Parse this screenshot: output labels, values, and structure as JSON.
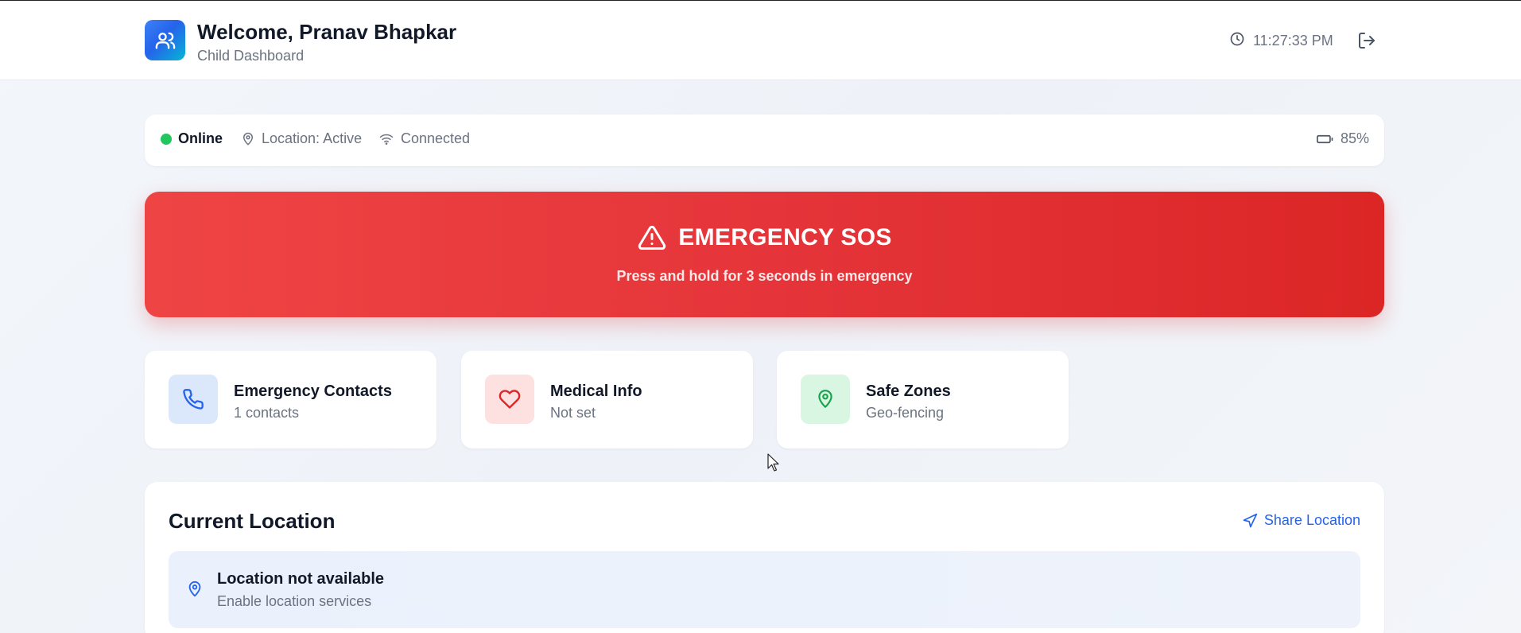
{
  "header": {
    "welcome": "Welcome, Pranav Bhapkar",
    "subtitle": "Child Dashboard",
    "time": "11:27:33 PM",
    "brand_icon": "users-icon",
    "clock_icon": "clock-icon",
    "logout_icon": "logout-icon"
  },
  "status": {
    "online": "Online",
    "location": "Location: Active",
    "connection": "Connected",
    "battery": "85%",
    "online_color": "#22c55e"
  },
  "sos": {
    "title": "EMERGENCY SOS",
    "subtitle": "Press and hold for 3 seconds in emergency",
    "icon": "warning-triangle-icon",
    "color": "#ef4444"
  },
  "cards": [
    {
      "title": "Emergency Contacts",
      "subtitle": "1 contacts",
      "icon": "phone-icon",
      "color": "#2563eb"
    },
    {
      "title": "Medical Info",
      "subtitle": "Not set",
      "icon": "heart-icon",
      "color": "#dc2626"
    },
    {
      "title": "Safe Zones",
      "subtitle": "Geo-fencing",
      "icon": "map-pin-icon",
      "color": "#16a34a"
    }
  ],
  "location": {
    "title": "Current Location",
    "share_label": "Share Location",
    "status_title": "Location not available",
    "status_sub": "Enable location services"
  }
}
